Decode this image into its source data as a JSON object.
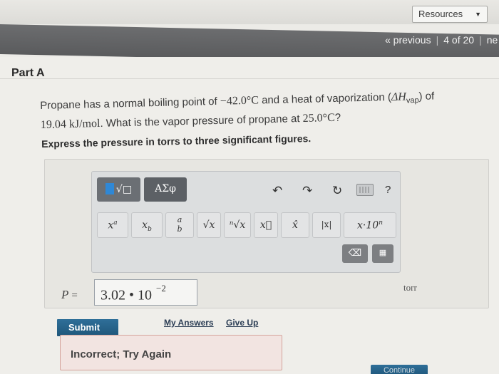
{
  "header": {
    "resources_label": "Resources",
    "caret": "▼",
    "previous_label": "« previous",
    "position": "4 of 20",
    "next_label": "ne"
  },
  "part": {
    "title": "Part A"
  },
  "question": {
    "line1_pre": "Propane has a normal boiling point of ",
    "boiling_point": "−42.0°C",
    "line1_mid": " and a heat of vaporization (",
    "delta_h": "ΔH",
    "vap_sub": "vap",
    "line1_end": ") of",
    "heat_value": "19.04 kJ/mol",
    "line2": ". What is the vapor pressure of propane at ",
    "temperature": "25.0°C",
    "line2_end": "?"
  },
  "instruction": "Express the pressure in torrs to three significant figures.",
  "toolbar": {
    "templates_tab": "√□",
    "symbols_tab": "ΑΣφ",
    "undo_icon": "undo-icon",
    "redo_icon": "redo-icon",
    "reset_icon": "reset-icon",
    "help_label": "?",
    "buttons": [
      "xa",
      "xb",
      "a/b",
      "√x",
      "ⁿ√x",
      "x⃗",
      "x̂",
      "|x|",
      "x·10ⁿ"
    ],
    "backspace": "⌫",
    "keypad": "keypad-icon"
  },
  "answer": {
    "variable": "P",
    "equals": "=",
    "value": "3.02 • 10",
    "exponent": "−2",
    "unit": "torr"
  },
  "actions": {
    "submit": "Submit",
    "my_answers": "My Answers",
    "give_up": "Give Up",
    "continue": "Continue"
  },
  "feedback": "Incorrect; Try Again",
  "colors": {
    "accent": "#1f567a",
    "nav": "#5a5b5d",
    "feedback_bg": "#f2e4e1"
  }
}
